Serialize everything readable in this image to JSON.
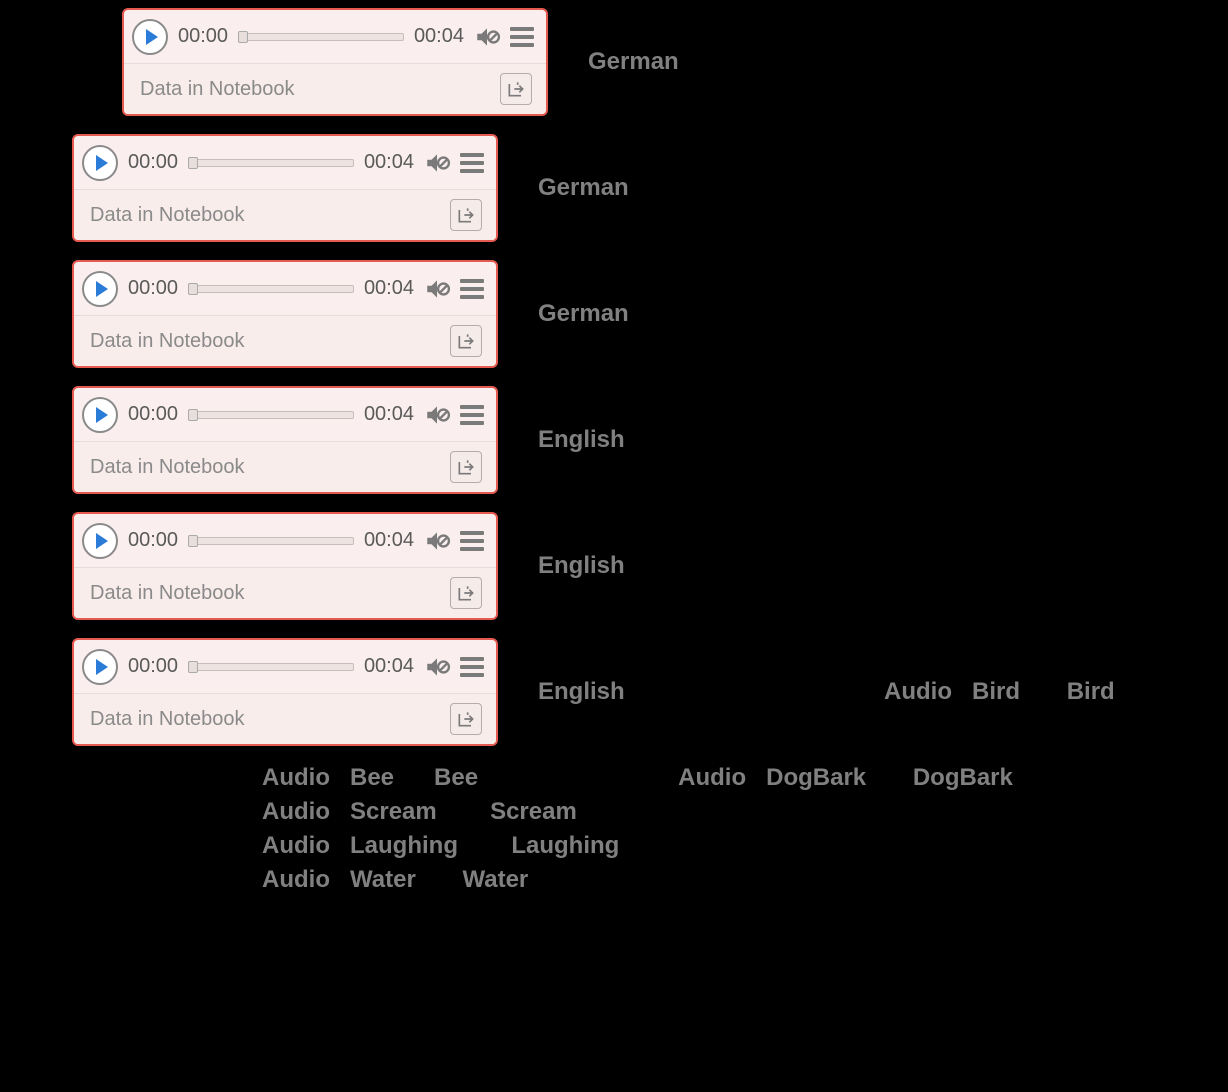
{
  "audio_cell": {
    "current_time": "00:00",
    "duration": "00:04",
    "source_label": "Data in Notebook"
  },
  "rows": [
    {
      "indent": "indent-0",
      "label": "German"
    },
    {
      "indent": "indent-1",
      "label": "German"
    },
    {
      "indent": "indent-1",
      "label": "German"
    },
    {
      "indent": "indent-1",
      "label": "English"
    },
    {
      "indent": "indent-1",
      "label": "English"
    },
    {
      "indent": "indent-1",
      "label": "English"
    }
  ],
  "row6_audio_entry": {
    "func": "Audio",
    "name": "Bird",
    "label": "Bird"
  },
  "extra_entries": [
    {
      "line": [
        {
          "func": "Audio",
          "name": "Bee",
          "label": "Bee"
        },
        {
          "func": "Audio",
          "name": "DogBark",
          "label": "DogBark"
        }
      ]
    },
    {
      "line": [
        {
          "func": "Audio",
          "name": "Scream",
          "label": "Scream"
        }
      ]
    },
    {
      "line": [
        {
          "func": "Audio",
          "name": "Laughing",
          "label": "Laughing"
        }
      ]
    },
    {
      "line": [
        {
          "func": "Audio",
          "name": "Water",
          "label": "Water"
        }
      ]
    }
  ]
}
